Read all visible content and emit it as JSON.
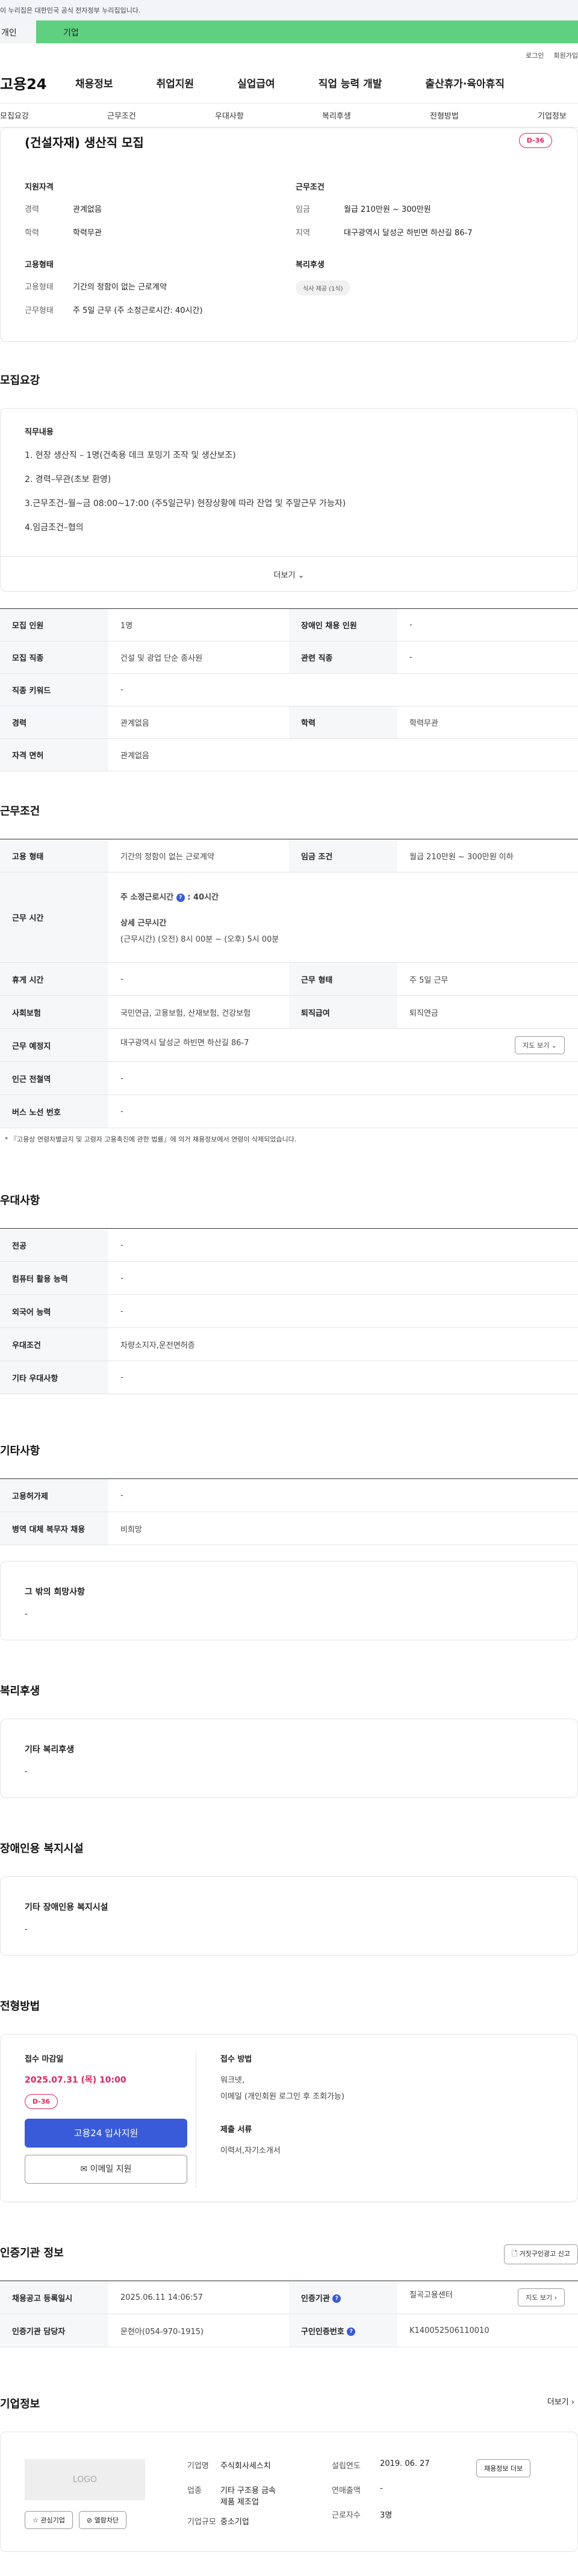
{
  "gov_banner": "이 누리집은 대한민국 공식 전자정부 누리집입니다.",
  "top_tabs": {
    "left": "개인",
    "right": "기업"
  },
  "util": {
    "login": "로그인",
    "join": "회원가입"
  },
  "gnb": {
    "logo": "고용24",
    "menu": [
      "채용정보",
      "취업지원",
      "실업급여",
      "직업 능력 개발",
      "출산휴가·육아휴직"
    ]
  },
  "subnav": [
    "모집요강",
    "근무조건",
    "우대사항",
    "복리후생",
    "전형방법",
    "기업정보"
  ],
  "summary": {
    "title": "(건설자재) 생산직 모집",
    "dday": "D-36",
    "qual_heading": "지원자격",
    "qual_rows": [
      {
        "k": "경력",
        "v": "관계없음"
      },
      {
        "k": "학력",
        "v": "학력무관"
      }
    ],
    "emp_heading": "고용형태",
    "emp_rows": [
      {
        "k": "고용형태",
        "v": "기간의 정함이 없는 근로계약"
      },
      {
        "k": "근무형태",
        "v": "주 5일 근무 (주 소정근로시간: 40시간)"
      }
    ],
    "cond_heading": "근무조건",
    "cond_rows": [
      {
        "k": "임금",
        "v": "월급 210만원 ~ 300만원"
      },
      {
        "k": "지역",
        "v": "대구광역시 달성군 하빈면 하산길 86-7"
      }
    ],
    "welfare_heading": "복리후생",
    "welfare_chip": "식사 제공 (1식)"
  },
  "recruit": {
    "section_title": "모집요강",
    "duty_heading": "직무내용",
    "duty_lines": [
      "1. 현장 생산직 – 1명(건축용 데크 포밍기 조작 및 생산보조)",
      "2. 경력–무관(초보 환영)",
      "3.근무조건–월~금 08:00~17:00 (주5일근무) 현장상황에 따라 잔업 및 주말근무 가능자)",
      "4.임금조건–협의"
    ],
    "more": "더보기",
    "table": [
      {
        "k1": "모집 인원",
        "v1": "1명",
        "k2": "장애인 채용 인원",
        "v2": "-"
      },
      {
        "k1": "모집 직종",
        "v1": "건설 및 광업 단순 종사원",
        "k2": "관련 직종",
        "v2": "-"
      },
      {
        "k1": "직종 키워드",
        "v1": "-"
      },
      {
        "k1": "경력",
        "v1": "관계없음",
        "k2": "학력",
        "v2": "학력무관"
      },
      {
        "k1": "자격 면허",
        "v1": "관계없음"
      }
    ]
  },
  "work": {
    "section_title": "근무조건",
    "emp_type_k": "고용 형태",
    "emp_type_v": "기간의 정함이 없는 근로계약",
    "wage_k": "임금 조건",
    "wage_v": "월급 210만원 ~ 300만원 이하",
    "hours_k": "근무 시간",
    "hours_weekly": "주 소정근로시간",
    "hours_weekly_v": "40시간",
    "hours_detail_h": "상세 근무시간",
    "hours_detail_v": "(근무시간) (오전) 8시 00분 ~ (오후) 5시 00분",
    "rest_k": "휴게 시간",
    "rest_v": "-",
    "form_k": "근무 형태",
    "form_v": "주 5일 근무",
    "ins_k": "사회보험",
    "ins_v": "국민연금, 고용보험, 산재보험, 건강보험",
    "sev_k": "퇴직급여",
    "sev_v": "퇴직연금",
    "place_k": "근무 예정지",
    "place_v": "대구광역시 달성군 하빈면 하산길 86-7",
    "map_btn": "지도 보기",
    "subway_k": "인근 전철역",
    "subway_v": "-",
    "bus_k": "버스 노선 번호",
    "bus_v": "-",
    "note": "* 『고용상 연령차별금지 및 고령자 고용촉진에 관한 법률』에 의거 채용정보에서 연령이 삭제되었습니다."
  },
  "pref": {
    "section_title": "우대사항",
    "rows": [
      {
        "k": "전공",
        "v": "-"
      },
      {
        "k": "컴퓨터 활용 능력",
        "v": "-"
      },
      {
        "k": "외국어 능력",
        "v": "-"
      },
      {
        "k": "우대조건",
        "v": "차량소지자,운전면허증"
      },
      {
        "k": "기타 우대사항",
        "v": "-"
      }
    ]
  },
  "etc": {
    "section_title": "기타사항",
    "rows": [
      {
        "k": "고용허가제",
        "v": "-"
      },
      {
        "k": "병역 대체 복무자 채용",
        "v": "비희망"
      }
    ],
    "hope_h": "그 밖의 희망사항",
    "hope_v": "-"
  },
  "welfare": {
    "section_title": "복리후생",
    "h": "기타 복리후생",
    "v": "-"
  },
  "disabled": {
    "section_title": "장애인용 복지시설",
    "h": "기타 장애인용 복지시설",
    "v": "-"
  },
  "apply": {
    "section_title": "전형방법",
    "deadline_h": "접수 마감일",
    "deadline_v": "2025.07.31 (목) 10:00",
    "dday": "D-36",
    "btn_apply": "고용24 입사지원",
    "btn_email": "이메일 지원",
    "method_h": "접수 방법",
    "method_v1": "워크넷,",
    "method_v2": "이메일 (개인회원 로그인 후 조회가능)",
    "docs_h": "제출 서류",
    "docs_v": "이력서,자기소개서"
  },
  "cert": {
    "section_title": "인증기관 정보",
    "report_btn": "거짓구인광고 신고",
    "reg_k": "채용공고 등록일시",
    "reg_v": "2025.06.11 14:06:57",
    "org_k": "인증기관",
    "org_v": "칠곡고용센터",
    "map_btn": "지도 보기",
    "mgr_k": "인증기관 담당자",
    "mgr_v": "문현아(054-970-1915)",
    "id_k": "구인인증번호",
    "id_v": "K140052506110010"
  },
  "company": {
    "section_title": "기업정보",
    "more": "더보기",
    "logo": "LOGO",
    "fav_btn": "관심기업",
    "block_btn": "열람차단",
    "name_k": "기업명",
    "name_v": "주식회사세스치",
    "est_k": "설립연도",
    "est_v": "2019. 06. 27",
    "industry_k": "업종",
    "industry_v1": "기타 구조용 금속",
    "industry_v2": "제품 제조업",
    "sales_k": "연매출액",
    "sales_v": "-",
    "emp_k": "근로자수",
    "emp_v": "3명",
    "size_k": "기업규모",
    "size_v": "중소기업",
    "jobs_btn": "채용정보 더보"
  }
}
